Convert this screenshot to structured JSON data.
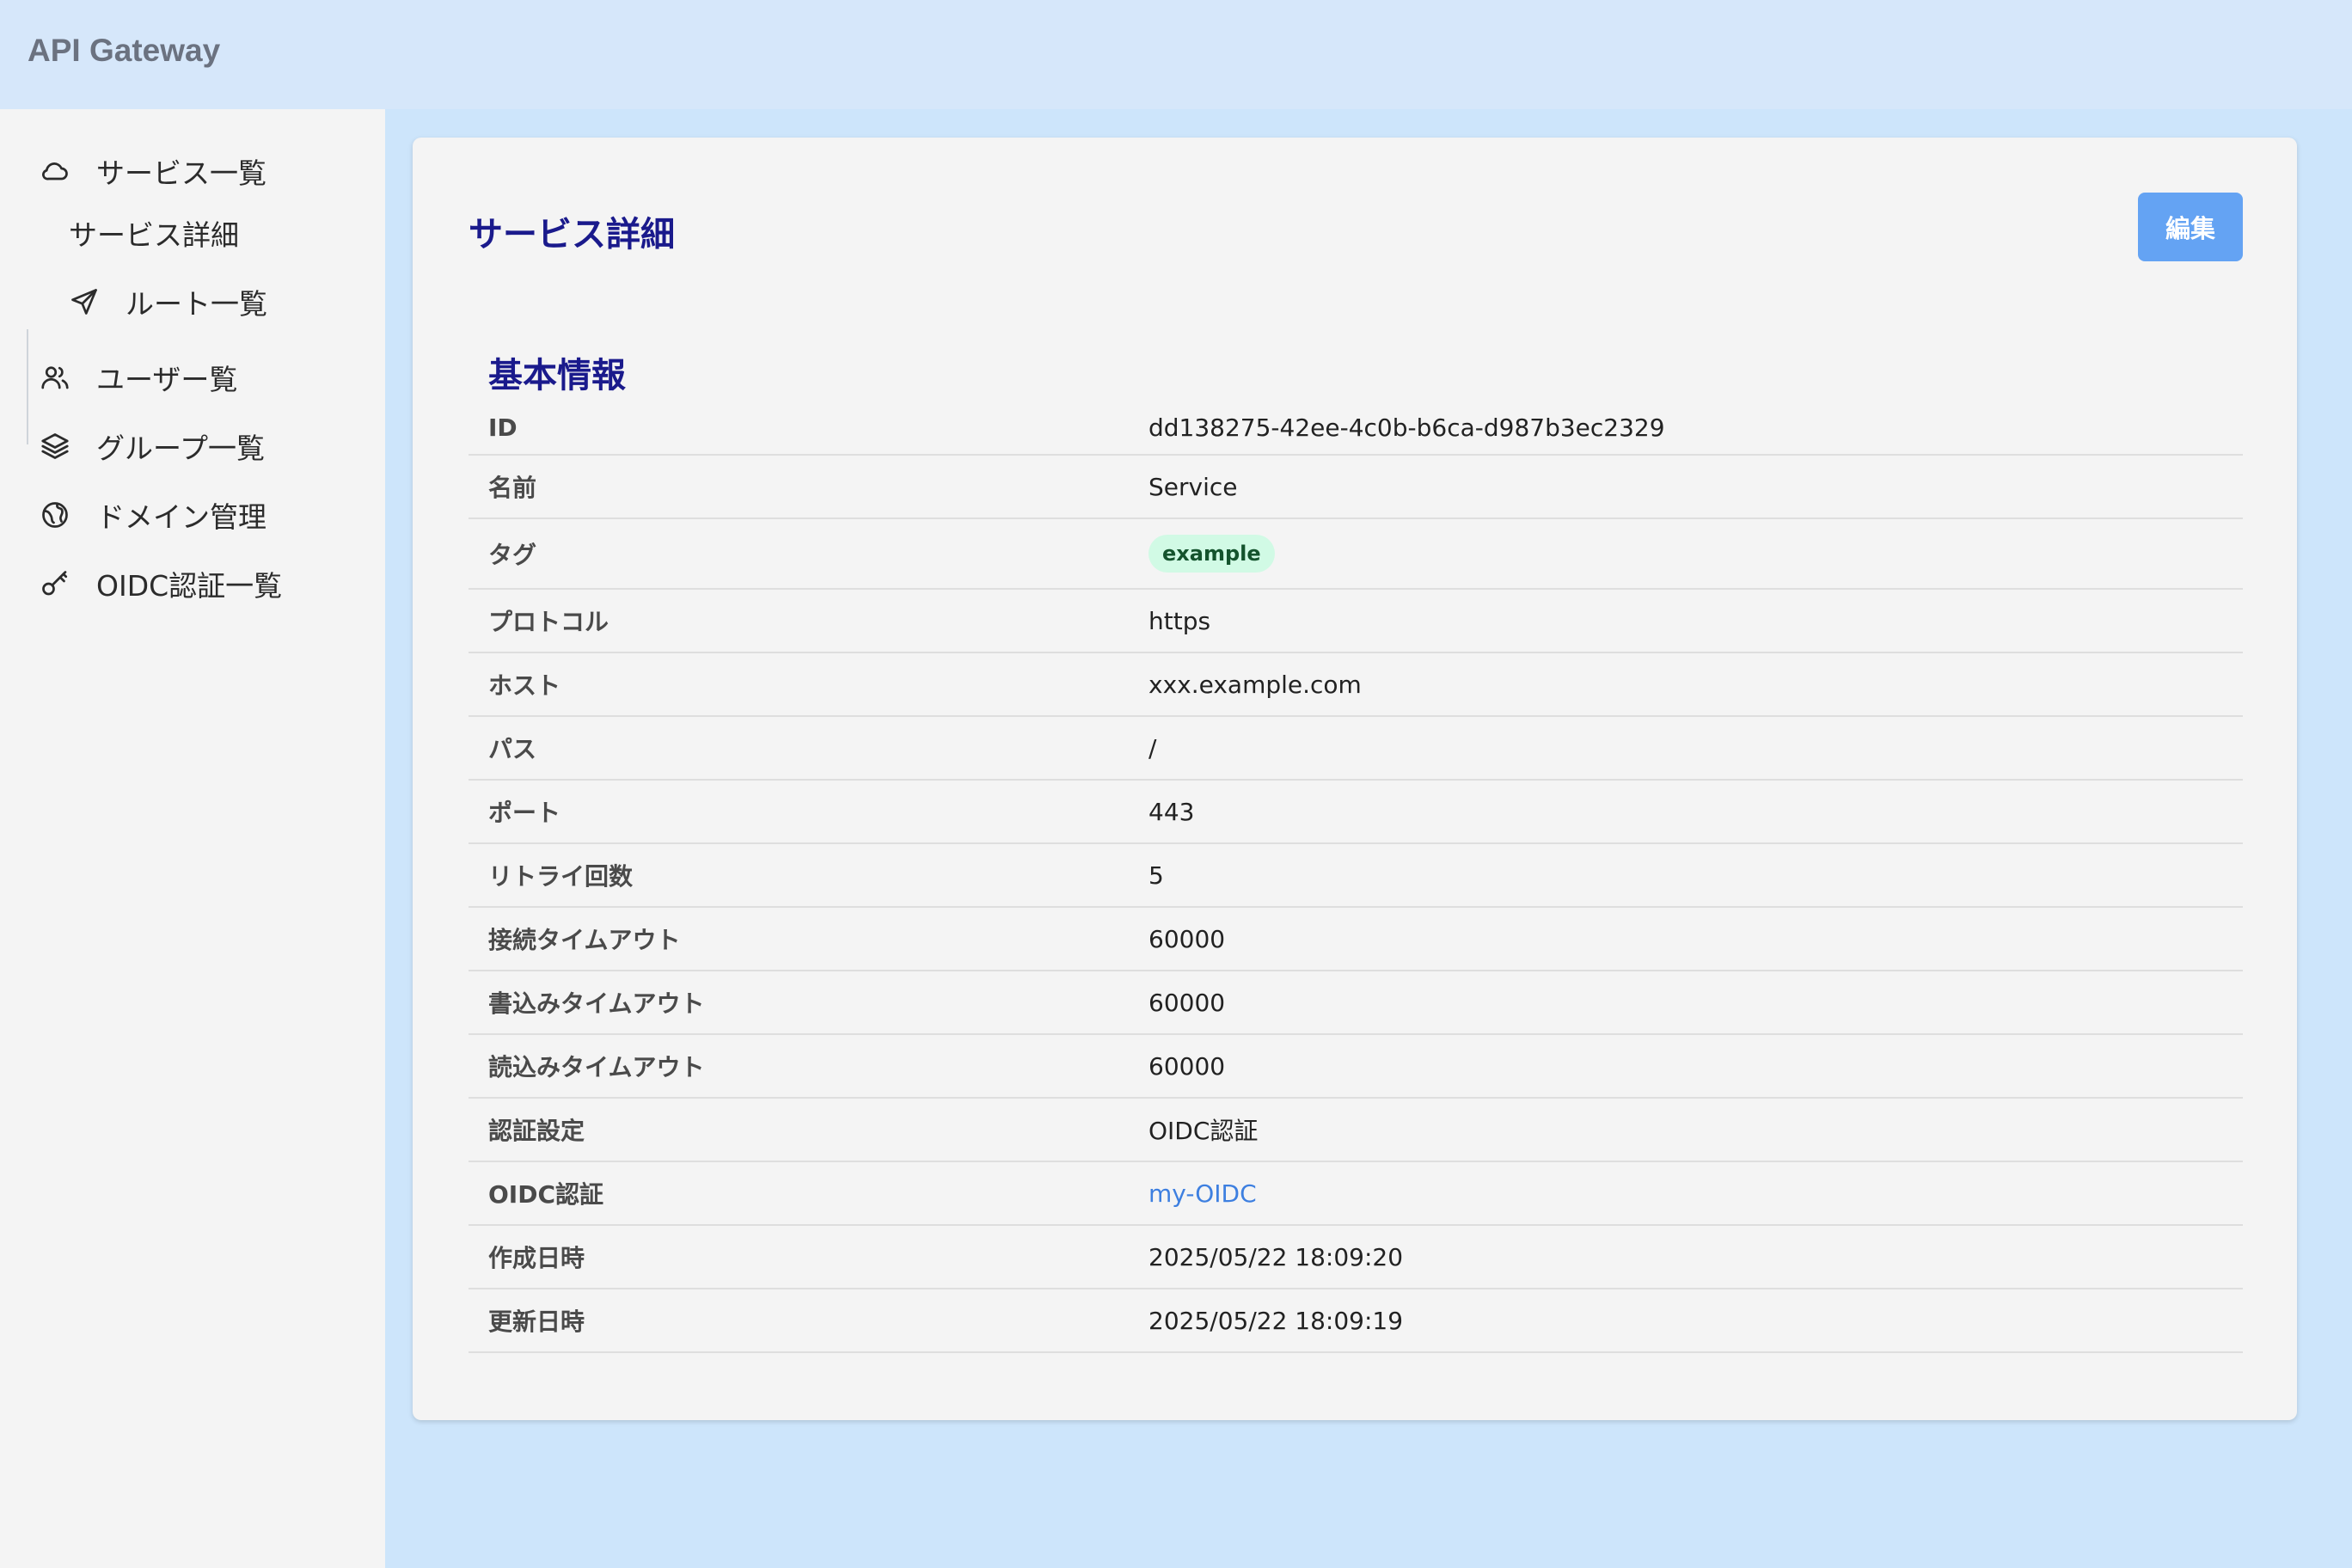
{
  "header": {
    "app_title": "API Gateway"
  },
  "sidebar": {
    "items": [
      {
        "label": "サービス一覧",
        "icon": "cloud-icon"
      },
      {
        "label": "サービス詳細",
        "icon": ""
      },
      {
        "label": "ルート一覧",
        "icon": "send-icon"
      },
      {
        "label": "ユーザー覧",
        "icon": "users-icon"
      },
      {
        "label": "グループ一覧",
        "icon": "layers-icon"
      },
      {
        "label": "ドメイン管理",
        "icon": "globe-icon"
      },
      {
        "label": "OIDC認証一覧",
        "icon": "key-icon"
      }
    ]
  },
  "main": {
    "page_title": "サービス詳細",
    "edit_label": "編集",
    "section_title": "基本情報",
    "rows": [
      {
        "label": "ID",
        "value": "dd138275-42ee-4c0b-b6ca-d987b3ec2329"
      },
      {
        "label": "名前",
        "value": "Service"
      },
      {
        "label": "タグ",
        "value": "example"
      },
      {
        "label": "プロトコル",
        "value": "https"
      },
      {
        "label": "ホスト",
        "value": "xxx.example.com"
      },
      {
        "label": "パス",
        "value": "/"
      },
      {
        "label": "ポート",
        "value": "443"
      },
      {
        "label": "リトライ回数",
        "value": "5"
      },
      {
        "label": "接続タイムアウト",
        "value": "60000"
      },
      {
        "label": "書込みタイムアウト",
        "value": "60000"
      },
      {
        "label": "読込みタイムアウト",
        "value": "60000"
      },
      {
        "label": "認証設定",
        "value": "OIDC認証"
      },
      {
        "label": "OIDC認証",
        "value": "my-OIDC"
      },
      {
        "label": "作成日時",
        "value": "2025/05/22 18:09:20"
      },
      {
        "label": "更新日時",
        "value": "2025/05/22 18:09:19"
      }
    ]
  },
  "colors": {
    "accent": "#64a3f3",
    "title": "#1a1a8c",
    "link": "#3d7fe0",
    "tag_bg": "#d1fae5"
  }
}
